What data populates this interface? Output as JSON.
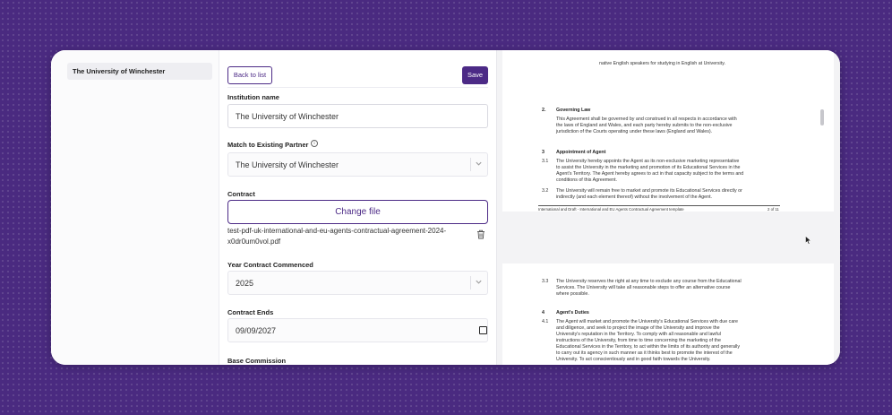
{
  "sidebar": {
    "items": [
      {
        "label": "The University of Winchester"
      }
    ]
  },
  "toolbar": {
    "back_label": "Back to list",
    "save_label": "Save"
  },
  "form": {
    "institution_name": {
      "label": "Institution name",
      "value": "The University of Winchester"
    },
    "match_partner": {
      "label": "Match to Existing Partner",
      "value": "The University of Winchester"
    },
    "contract": {
      "label": "Contract",
      "button_label": "Change file",
      "filename": "test-pdf-uk-international-and-eu-agents-contractual-agreement-2024-x0dr0um0vol.pdf"
    },
    "year_commenced": {
      "label": "Year Contract Commenced",
      "value": "2025"
    },
    "contract_ends": {
      "label": "Contract Ends",
      "value": "09/09/2027"
    },
    "base_commission": {
      "label": "Base Commission"
    }
  },
  "preview": {
    "top_line": "native English speakers for studying in English at University.",
    "sections": [
      {
        "num": "2.",
        "title": "Governing Law"
      },
      {
        "num": "3",
        "title": "Appointment of Agent"
      },
      {
        "num": "4",
        "title": "Agent's Duties"
      }
    ],
    "governing_law": [
      "This Agreement shall be governed by and construed in all respects in accordance with",
      "the laws of England and Wales, and each party hereby submits to the non-exclusive",
      "jurisdiction of the Courts operating under these laws (England and Wales)."
    ],
    "clause_3_1": {
      "num": "3.1",
      "lines": [
        "The University hereby appoints the Agent as its non-exclusive marketing representative",
        "to assist the University in the marketing and promotion of its Educational Services in the",
        "Agent's Territory. The Agent hereby agrees to act in that capacity subject to the terms and",
        "conditions of this Agreement."
      ]
    },
    "clause_3_2": {
      "num": "3.2",
      "lines": [
        "The University will remain free to market and promote its Educational Services directly or",
        "indirectly (and each element thereof) without the involvement of the Agent."
      ]
    },
    "footer": {
      "left": "International and Draft - International and EU Agents Contractual Agreement template",
      "right": "2 of 11"
    },
    "clause_3_3": {
      "num": "3.3",
      "lines": [
        "The University reserves the right at any time to exclude any course from the Educational",
        "Services. The University will take all reasonable steps to offer an alternative course",
        "where possible."
      ]
    },
    "clause_4_1": {
      "num": "4.1",
      "lines": [
        "The Agent will market and promote the University's Educational Services with due care",
        "and diligence, and seek to project the image of the University and improve the",
        "University's reputation in the Territory. To comply with all reasonable and lawful",
        "instructions of the University, from time to time concerning the marketing of the",
        "Educational Services in the Territory, to act within the limits of its authority and generally",
        "to carry out its agency in such manner as it thinks best to promote the interest of the",
        "University. To act conscientiously and in good faith towards the University."
      ]
    }
  },
  "colors": {
    "brand": "#4c2a86",
    "background": "#4a2a80"
  },
  "icons": [
    "info-icon",
    "chevron-down-icon",
    "trash-icon",
    "checkbox-icon",
    "cursor-icon"
  ]
}
